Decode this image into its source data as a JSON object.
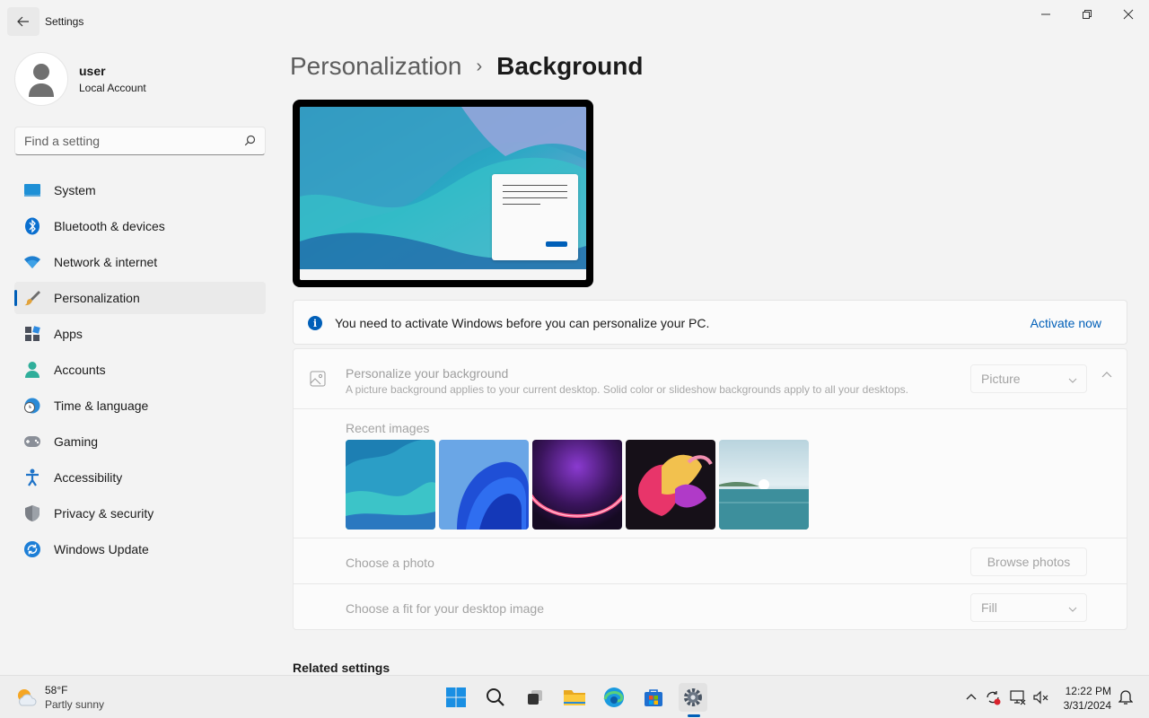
{
  "window": {
    "title": "Settings"
  },
  "profile": {
    "name": "user",
    "account_type": "Local Account"
  },
  "search": {
    "placeholder": "Find a setting"
  },
  "sidebar": {
    "items": [
      {
        "label": "System",
        "icon": "system-icon"
      },
      {
        "label": "Bluetooth & devices",
        "icon": "bluetooth-icon"
      },
      {
        "label": "Network & internet",
        "icon": "wifi-icon"
      },
      {
        "label": "Personalization",
        "icon": "brush-icon",
        "active": true
      },
      {
        "label": "Apps",
        "icon": "apps-icon"
      },
      {
        "label": "Accounts",
        "icon": "person-icon"
      },
      {
        "label": "Time & language",
        "icon": "clock-globe-icon"
      },
      {
        "label": "Gaming",
        "icon": "gamepad-icon"
      },
      {
        "label": "Accessibility",
        "icon": "accessibility-icon"
      },
      {
        "label": "Privacy & security",
        "icon": "shield-icon"
      },
      {
        "label": "Windows Update",
        "icon": "update-icon"
      }
    ]
  },
  "breadcrumb": {
    "parent": "Personalization",
    "separator": "›",
    "current": "Background"
  },
  "banner": {
    "text": "You need to activate Windows before you can personalize your PC.",
    "link": "Activate now"
  },
  "background_card": {
    "title": "Personalize your background",
    "description": "A picture background applies to your current desktop. Solid color or slideshow backgrounds apply to all your desktops.",
    "type_value": "Picture",
    "recent_label": "Recent images",
    "choose_photo_label": "Choose a photo",
    "browse_button": "Browse photos",
    "fit_label": "Choose a fit for your desktop image",
    "fit_value": "Fill"
  },
  "related": {
    "heading": "Related settings"
  },
  "taskbar": {
    "weather_temp": "58°F",
    "weather_condition": "Partly sunny",
    "time": "12:22 PM",
    "date": "3/31/2024"
  },
  "colors": {
    "accent": "#005fb8",
    "background": "#f3f3f3"
  }
}
